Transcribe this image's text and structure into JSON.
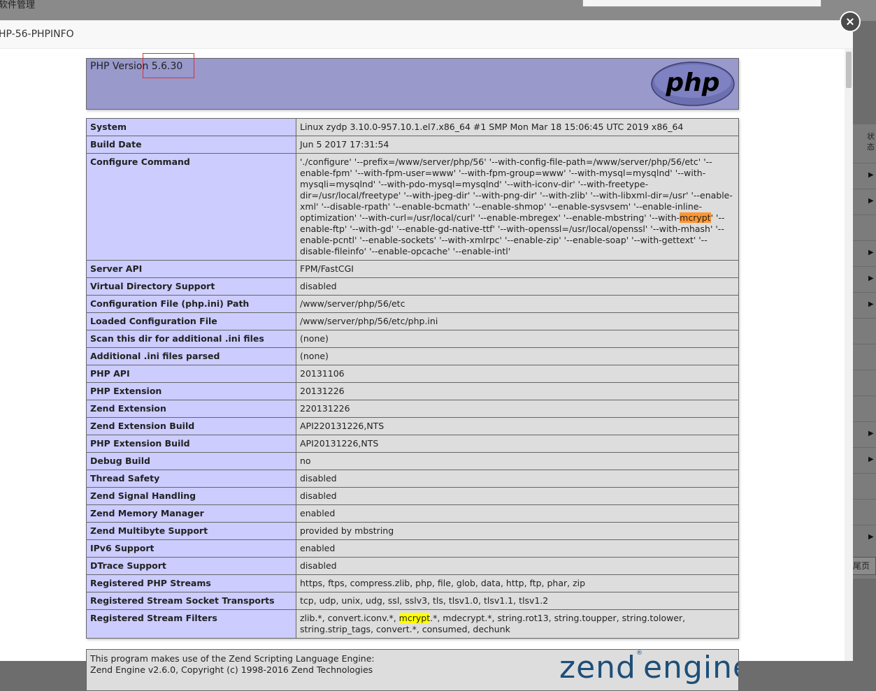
{
  "background": {
    "title": "软件管理",
    "status_header": "状态",
    "pagination_text": "尾页",
    "arrow_glyph": "▶"
  },
  "modal": {
    "title": "HP-56-PHPINFO"
  },
  "php": {
    "version_label": "PHP Version 5.6.30",
    "logo_text": "php",
    "rows": [
      {
        "key": "System",
        "value": "Linux zydp 3.10.0-957.10.1.el7.x86_64 #1 SMP Mon Mar 18 15:06:45 UTC 2019 x86_64"
      },
      {
        "key": "Build Date",
        "value": "Jun 5 2017 17:31:54"
      },
      {
        "key": "Configure Command",
        "value_before": "'./configure' '--prefix=/www/server/php/56' '--with-config-file-path=/www/server/php/56/etc' '--enable-fpm' '--with-fpm-user=www' '--with-fpm-group=www' '--with-mysql=mysqlnd' '--with-mysqli=mysqlnd' '--with-pdo-mysql=mysqlnd' '--with-iconv-dir' '--with-freetype-dir=/usr/local/freetype' '--with-jpeg-dir' '--with-png-dir' '--with-zlib' '--with-libxml-dir=/usr' '--enable-xml' '--disable-rpath' '--enable-bcmath' '--enable-shmop' '--enable-sysvsem' '--enable-inline-optimization' '--with-curl=/usr/local/curl' '--enable-mbregex' '--enable-mbstring' '--with-",
        "value_highlight": "mcrypt",
        "value_after": "' '--enable-ftp' '--with-gd' '--enable-gd-native-ttf' '--with-openssl=/usr/local/openssl' '--with-mhash' '--enable-pcntl' '--enable-sockets' '--with-xmlrpc' '--enable-zip' '--enable-soap' '--with-gettext' '--disable-fileinfo' '--enable-opcache' '--enable-intl'"
      },
      {
        "key": "Server API",
        "value": "FPM/FastCGI"
      },
      {
        "key": "Virtual Directory Support",
        "value": "disabled"
      },
      {
        "key": "Configuration File (php.ini) Path",
        "value": "/www/server/php/56/etc"
      },
      {
        "key": "Loaded Configuration File",
        "value": "/www/server/php/56/etc/php.ini"
      },
      {
        "key": "Scan this dir for additional .ini files",
        "value": "(none)"
      },
      {
        "key": "Additional .ini files parsed",
        "value": "(none)"
      },
      {
        "key": "PHP API",
        "value": "20131106"
      },
      {
        "key": "PHP Extension",
        "value": "20131226"
      },
      {
        "key": "Zend Extension",
        "value": "220131226"
      },
      {
        "key": "Zend Extension Build",
        "value": "API220131226,NTS"
      },
      {
        "key": "PHP Extension Build",
        "value": "API20131226,NTS"
      },
      {
        "key": "Debug Build",
        "value": "no"
      },
      {
        "key": "Thread Safety",
        "value": "disabled"
      },
      {
        "key": "Zend Signal Handling",
        "value": "disabled"
      },
      {
        "key": "Zend Memory Manager",
        "value": "enabled"
      },
      {
        "key": "Zend Multibyte Support",
        "value": "provided by mbstring"
      },
      {
        "key": "IPv6 Support",
        "value": "enabled"
      },
      {
        "key": "DTrace Support",
        "value": "disabled"
      },
      {
        "key": "Registered PHP Streams",
        "value": "https, ftps, compress.zlib, php, file, glob, data, http, ftp, phar, zip"
      },
      {
        "key": "Registered Stream Socket Transports",
        "value": "tcp, udp, unix, udg, ssl, sslv3, tls, tlsv1.0, tlsv1.1, tlsv1.2"
      },
      {
        "key": "Registered Stream Filters",
        "value_before": "zlib.*, convert.iconv.*, ",
        "value_highlight": "mcrypt",
        "value_after": ".*, mdecrypt.*, string.rot13, string.toupper, string.tolower, string.strip_tags, convert.*, consumed, dechunk"
      }
    ],
    "zend_line1": "This program makes use of the Zend Scripting Language Engine:",
    "zend_line2": "Zend Engine v2.6.0, Copyright (c) 1998-2016 Zend Technologies",
    "zend_logo_word1": "zend",
    "zend_logo_word2": "engine",
    "zend_logo_mark": "®"
  }
}
